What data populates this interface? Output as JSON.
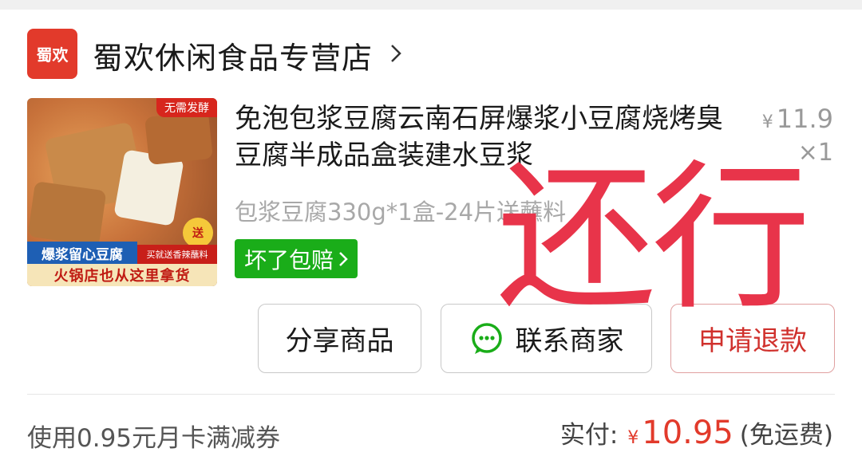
{
  "store": {
    "logo_text": "蜀欢",
    "name": "蜀欢休闲食品专营店"
  },
  "product": {
    "image": {
      "tag_top_right": "无需发酵",
      "band_blue": "爆浆留心豆腐",
      "band_red": "买就送香辣蘸料",
      "bottom_text": "火锅店也从这里拿货",
      "badge": "送"
    },
    "title": "免泡包浆豆腐云南石屏爆浆小豆腐烧烤臭豆腐半成品盒装建水豆浆",
    "spec": "包浆豆腐330g*1盒-24片送蘸料",
    "guarantee": "坏了包赔",
    "price_symbol": "¥",
    "price": "11.9",
    "quantity": "×1"
  },
  "actions": {
    "share": "分享商品",
    "contact": "联系商家",
    "refund": "申请退款"
  },
  "overlay_text": "还行",
  "footer": {
    "coupon": "使用0.95元月卡满减券",
    "pay_label": "实付:",
    "pay_symbol": "¥",
    "pay_amount": "10.95",
    "shipping": "(免运费)"
  },
  "colors": {
    "brand_red": "#e23a2b",
    "guarantee_green": "#1aad19",
    "refund_text": "#d0312d",
    "stamp": "#e8344a"
  }
}
